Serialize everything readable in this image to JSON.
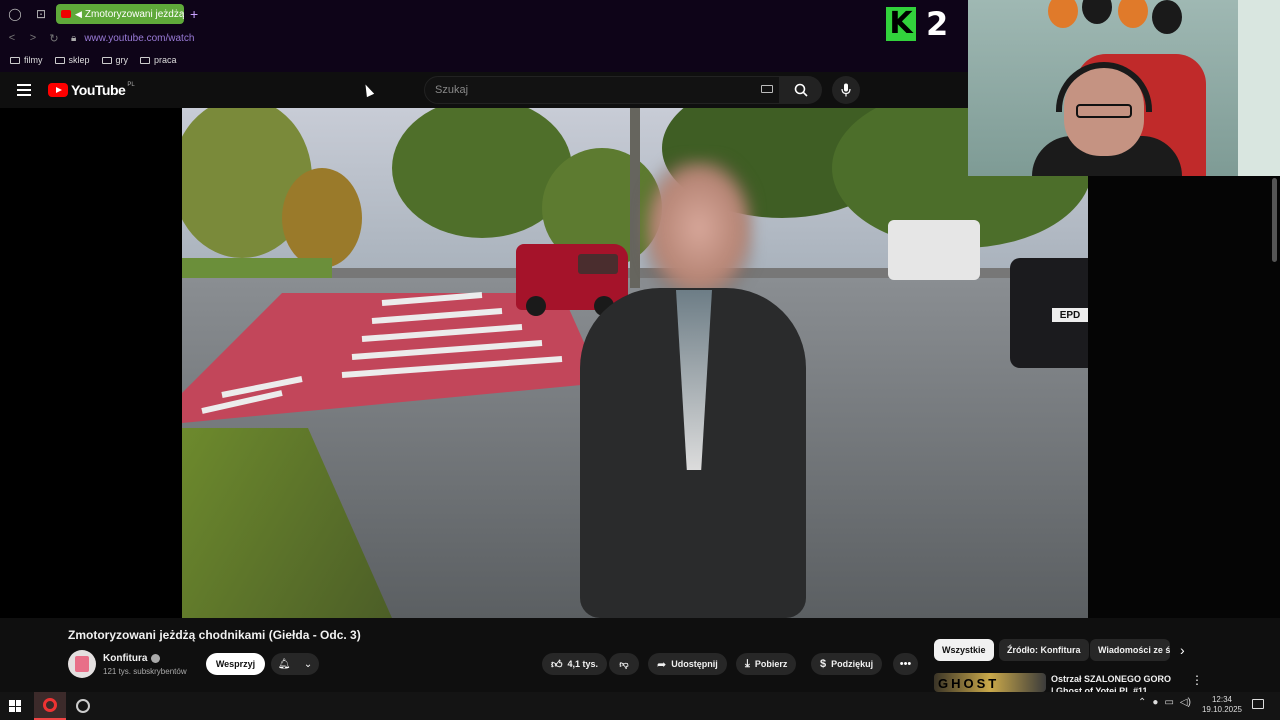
{
  "browser": {
    "tab_title": "Zmotoryzowani jeżdżą...",
    "url": "www.youtube.com/watch",
    "bookmarks": [
      "filmy",
      "sklep",
      "gry",
      "praca"
    ]
  },
  "overlay": {
    "logo_letter": "K",
    "logo_number": "2"
  },
  "youtube": {
    "logo_text": "YouTube",
    "country_code": "PL",
    "search_placeholder": "Szukaj"
  },
  "video": {
    "plate_text": "EPD",
    "title": "Zmotoryzowani jeżdżą chodnikami (Giełda - Odc. 3)",
    "channel": "Konfitura",
    "subscribers": "121 tys. subskrybentów",
    "join_label": "Wesprzyj",
    "likes": "4,1 tys.",
    "share_label": "Udostępnij",
    "download_label": "Pobierz",
    "thanks_label": "Podziękuj"
  },
  "sidebar": {
    "chips": [
      "Wszystkie",
      "Źródło: Konfitura",
      "Wiadomości ze ś"
    ],
    "recommendation": {
      "thumb_text": "GHOST",
      "title": "Ostrzał SZALONEGO GORO | Ghost of Yotei PL #11"
    }
  },
  "taskbar": {
    "time": "12:34",
    "date": "19.10.2025"
  },
  "colors": {
    "tab_green": "#5fa93a",
    "k2_green": "#32d23c",
    "youtube_red": "#ff0000"
  }
}
